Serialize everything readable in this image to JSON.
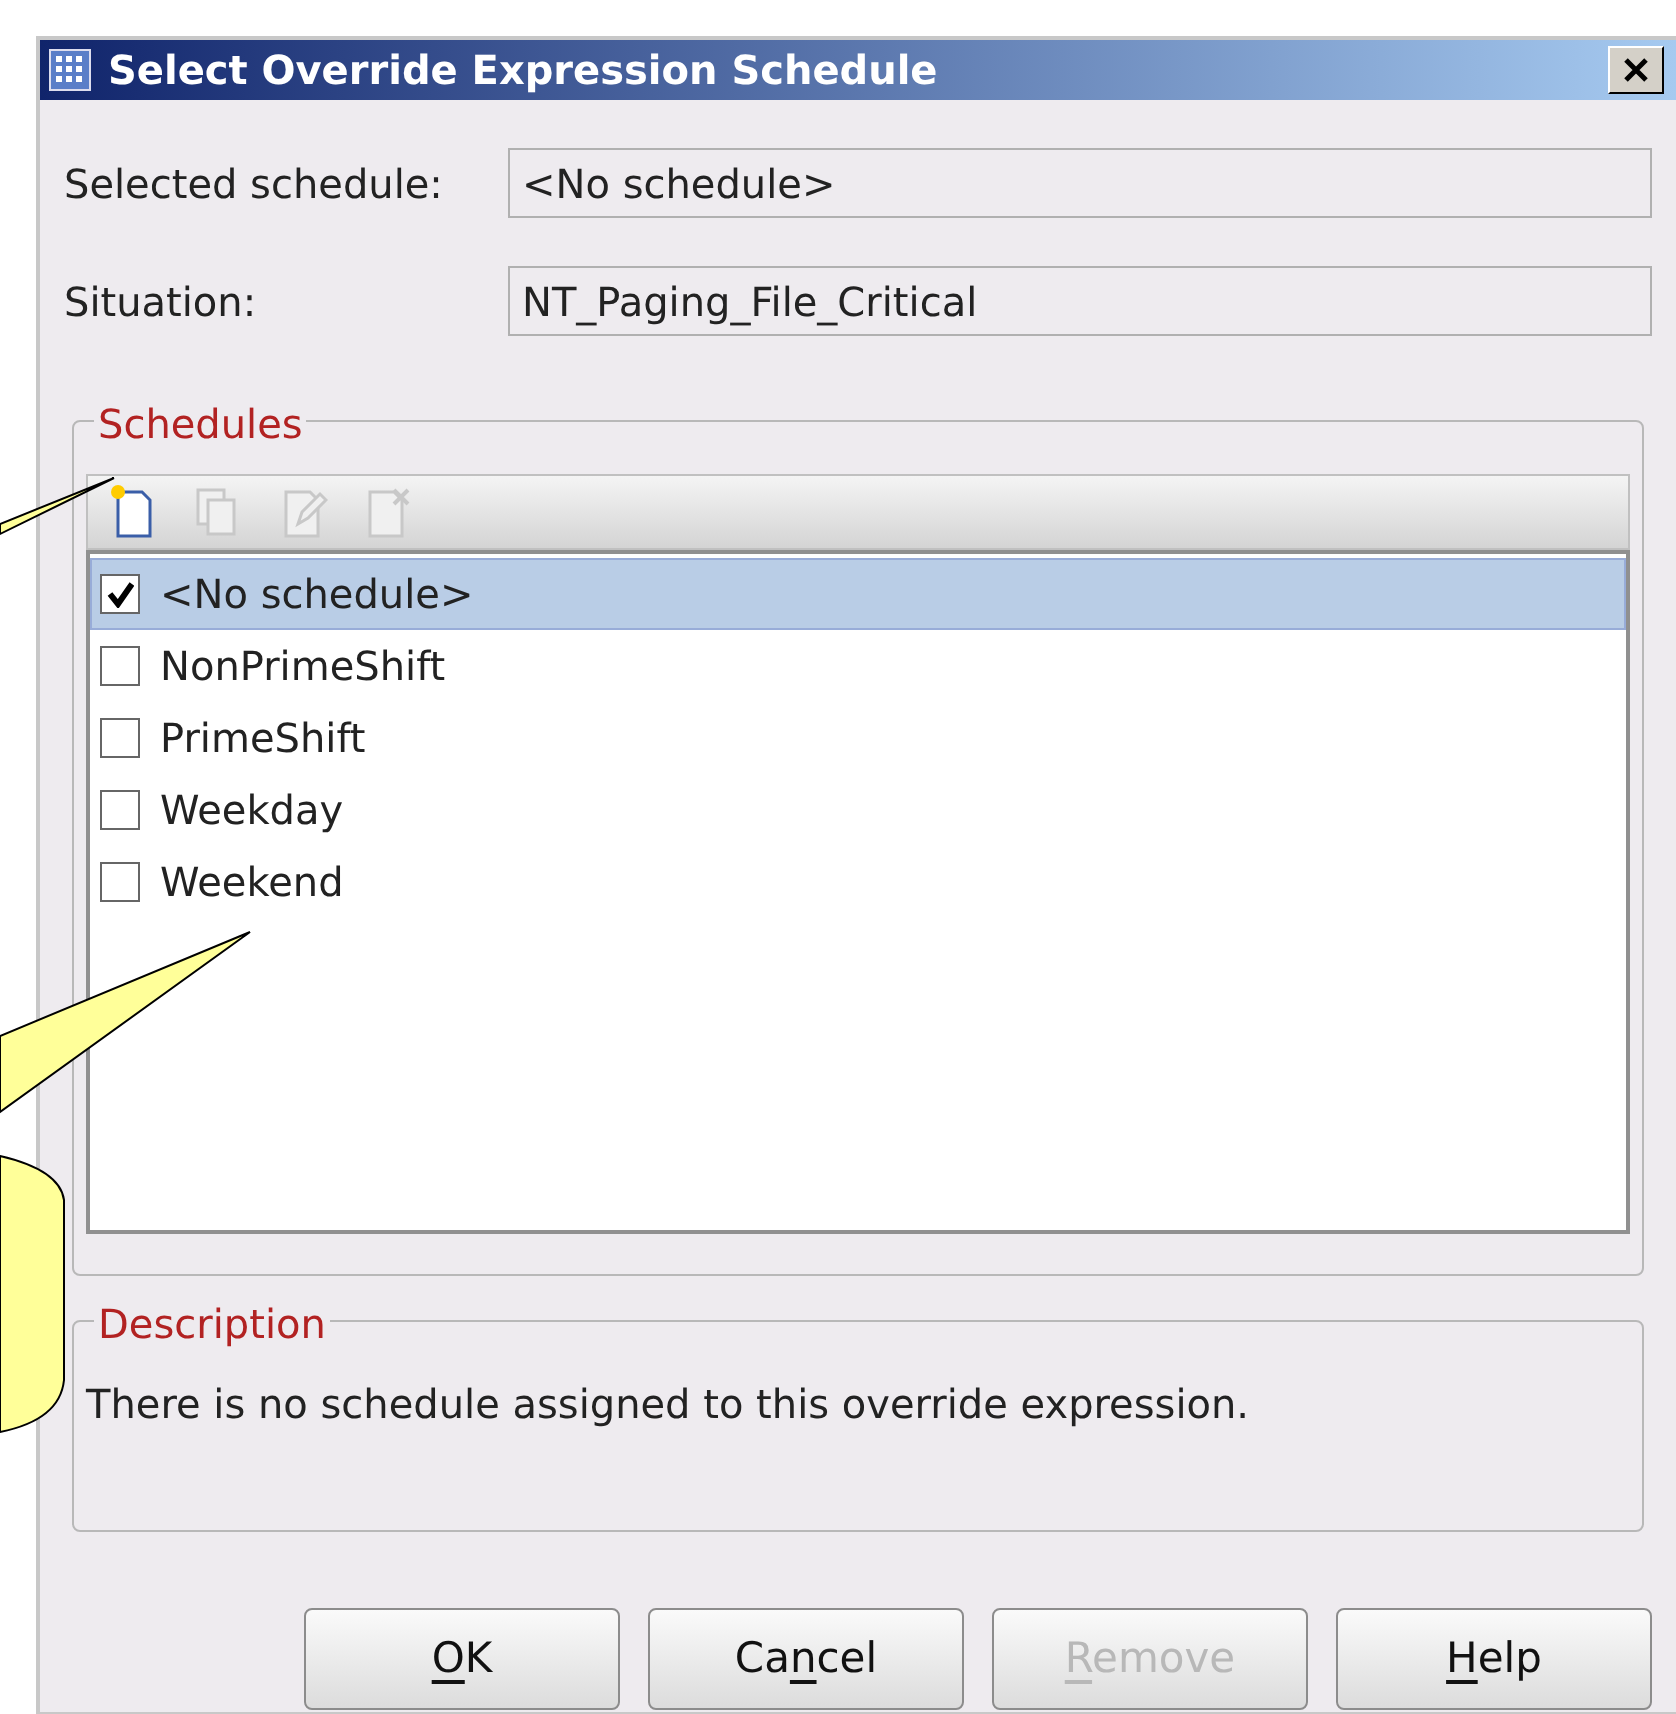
{
  "window": {
    "title": "Select Override Expression Schedule"
  },
  "fields": [
    {
      "label": "Selected schedule:",
      "value": "<No schedule>"
    },
    {
      "label": "Situation:",
      "value": "NT_Paging_File_Critical"
    }
  ],
  "schedules": {
    "title": "Schedules",
    "toolbar": [
      {
        "kind": "new",
        "disabled": false
      },
      {
        "kind": "copy",
        "disabled": true
      },
      {
        "kind": "edit",
        "disabled": true
      },
      {
        "kind": "delete",
        "disabled": true
      }
    ],
    "items": [
      {
        "label": "<No schedule>",
        "checked": true,
        "selected": true
      },
      {
        "label": "NonPrimeShift",
        "checked": false,
        "selected": false
      },
      {
        "label": "PrimeShift",
        "checked": false,
        "selected": false
      },
      {
        "label": "Weekday",
        "checked": false,
        "selected": false
      },
      {
        "label": "Weekend",
        "checked": false,
        "selected": false
      }
    ]
  },
  "description": {
    "title": "Description",
    "text": "There is no schedule assigned to this override expression."
  },
  "buttons": [
    {
      "mnemonic": "O",
      "rest": "K",
      "disabled": false
    },
    {
      "lead": "Ca",
      "mnemonic": "n",
      "rest": "cel",
      "disabled": false
    },
    {
      "mnemonic": "R",
      "rest": "emove",
      "disabled": true
    },
    {
      "mnemonic": "H",
      "rest": "elp",
      "disabled": false
    }
  ]
}
